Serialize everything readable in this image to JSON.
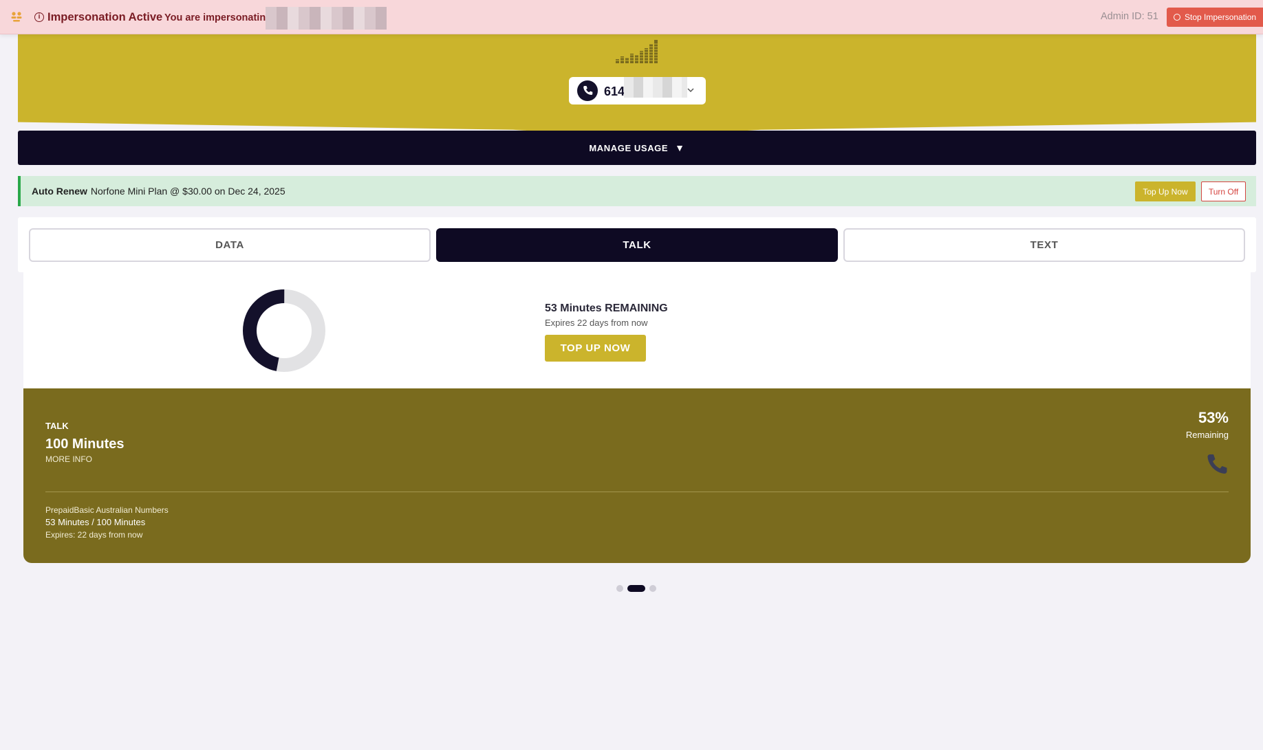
{
  "impersonation": {
    "title": "Impersonation Active",
    "message": "You are impersonating",
    "admin_id": "Admin ID: 51",
    "stop_label": "Stop Impersonation",
    "icon": "people-icon"
  },
  "account": {
    "phone_number_prefix": "614",
    "phone_icon": "phone-icon"
  },
  "manage_usage": {
    "label": "MANAGE USAGE",
    "arrow": "▼"
  },
  "auto_renew": {
    "label": "Auto Renew",
    "text": "Norfone Mini Plan @ $30.00 on Dec 24, 2025",
    "top_up_label": "Top Up Now",
    "turn_off_label": "Turn Off"
  },
  "tabs": [
    {
      "label": "DATA",
      "active": false
    },
    {
      "label": "TALK",
      "active": true
    },
    {
      "label": "TEXT",
      "active": false
    }
  ],
  "usage": {
    "remaining_title": "53 Minutes REMAINING",
    "expires": "Expires 22 days from now",
    "top_up_label": "TOP UP NOW",
    "remaining_fraction": 0.53
  },
  "plan_card": {
    "label": "TALK",
    "amount": "100 Minutes",
    "more_info": "MORE INFO",
    "percent": "53%",
    "percent_label": "Remaining",
    "plan_name": "PrepaidBasic Australian Numbers",
    "usage": "53 Minutes / 100 Minutes",
    "expires": "Expires: 22 days from now"
  },
  "pager": {
    "count": 3,
    "active_index": 1
  },
  "colors": {
    "brand_gold": "#cbb42c",
    "navy": "#0e0a23",
    "card_olive": "#7a6b1e",
    "alert_pink": "#f8d7da",
    "renew_green": "#d6eddc"
  }
}
